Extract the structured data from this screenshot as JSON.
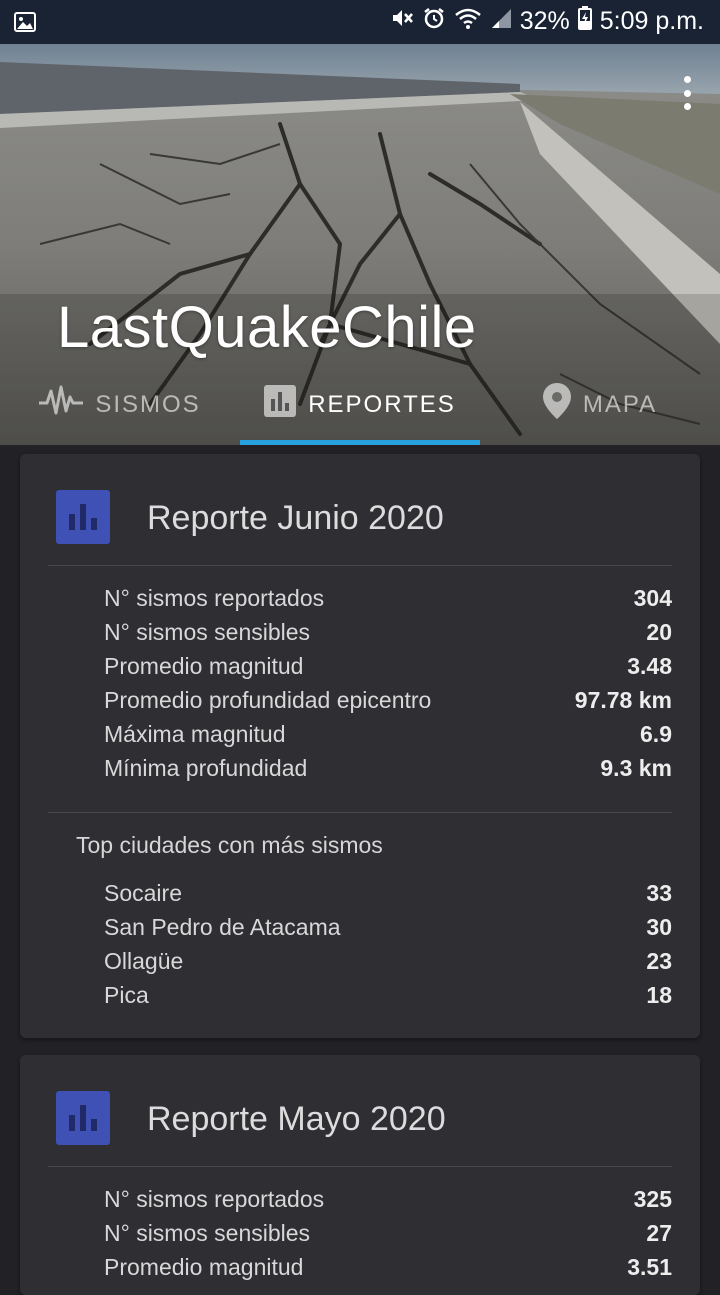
{
  "status_bar": {
    "battery": "32%",
    "time": "5:09 p.m.",
    "icons": [
      "image-notification-icon",
      "mute-icon",
      "alarm-icon",
      "wifi-icon",
      "signal-icon",
      "battery-icon"
    ]
  },
  "app": {
    "title": "LastQuakeChile",
    "menu_icon": "more-vert-icon"
  },
  "tabs": [
    {
      "label": "SISMOS",
      "icon": "seismograph-icon",
      "active": false
    },
    {
      "label": "REPORTES",
      "icon": "bar-chart-icon",
      "active": true
    },
    {
      "label": "MAPA",
      "icon": "map-pin-icon",
      "active": false
    }
  ],
  "reports": [
    {
      "title": "Reporte Junio 2020",
      "stats": [
        {
          "label": "N° sismos reportados",
          "value": "304"
        },
        {
          "label": "N° sismos sensibles",
          "value": "20"
        },
        {
          "label": "Promedio magnitud",
          "value": "3.48"
        },
        {
          "label": "Promedio profundidad epicentro",
          "value": "97.78 km"
        },
        {
          "label": "Máxima magnitud",
          "value": "6.9"
        },
        {
          "label": "Mínima profundidad",
          "value": "9.3 km"
        }
      ],
      "top_cities_heading": "Top ciudades con más sismos",
      "top_cities": [
        {
          "name": "Socaire",
          "count": "33"
        },
        {
          "name": "San Pedro de Atacama",
          "count": "30"
        },
        {
          "name": "Ollagüe",
          "count": "23"
        },
        {
          "name": "Pica",
          "count": "18"
        }
      ]
    },
    {
      "title": "Reporte Mayo 2020",
      "stats": [
        {
          "label": "N° sismos reportados",
          "value": "325"
        },
        {
          "label": "N° sismos sensibles",
          "value": "27"
        },
        {
          "label": "Promedio magnitud",
          "value": "3.51"
        }
      ]
    }
  ],
  "colors": {
    "status_bar": "#1a2334",
    "background": "#222226",
    "card": "#2e2e33",
    "accent_indicator": "#29a3e0",
    "report_icon": "#3f51b5"
  }
}
